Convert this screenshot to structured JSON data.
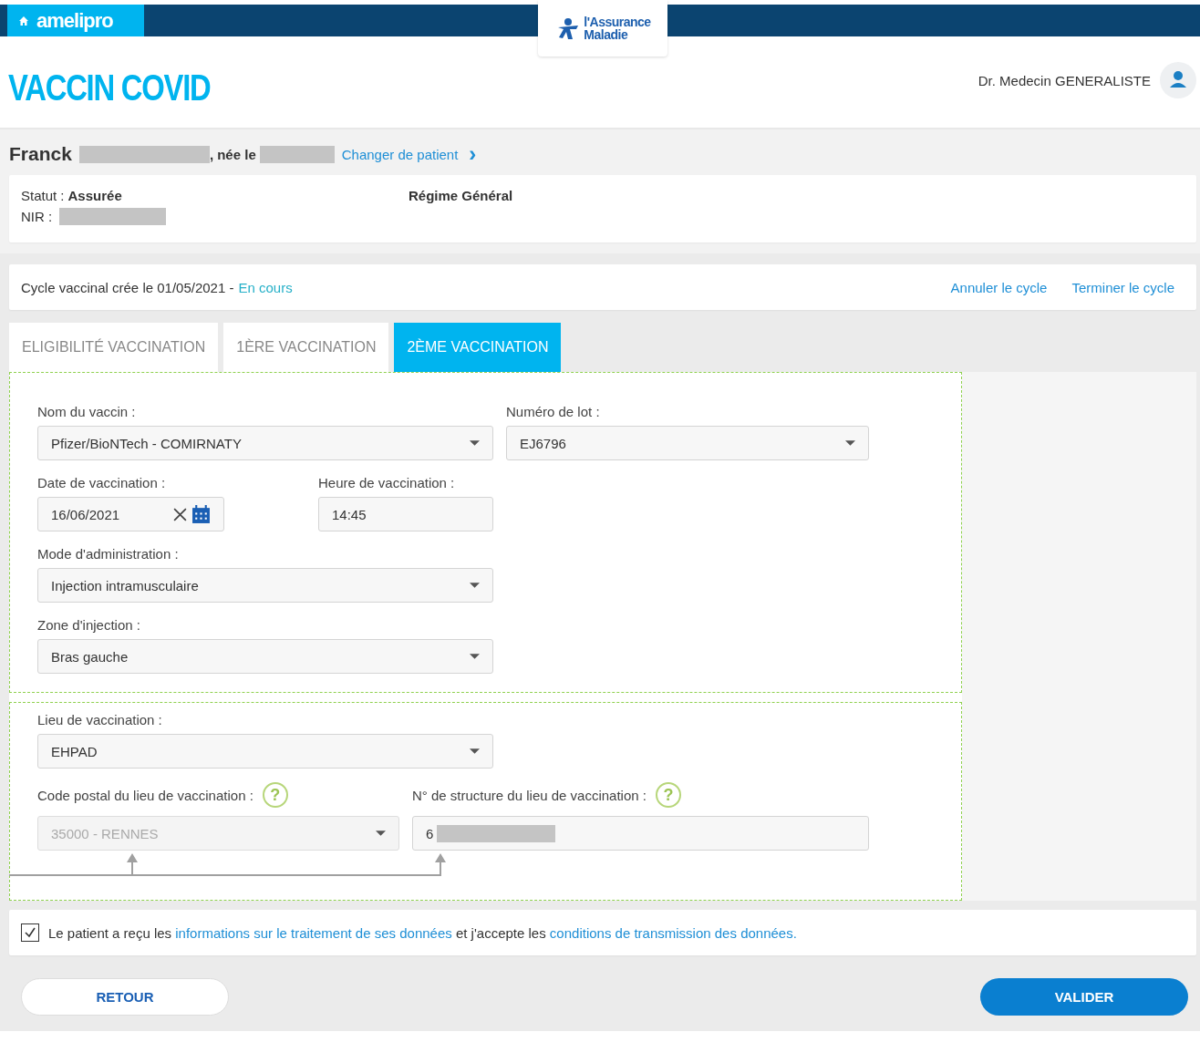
{
  "brand": {
    "name": "amelipro",
    "logo_line1": "l'Assurance",
    "logo_line2": "Maladie"
  },
  "title": "VACCIN COVID",
  "user": {
    "name": "Dr. Medecin GENERALISTE"
  },
  "patient": {
    "first_name": "Franck",
    "born_label": ", née le",
    "change_link": "Changer de patient",
    "chevron": "›"
  },
  "info": {
    "status_label": "Statut :",
    "status_value": "Assurée",
    "nir_label": "NIR :",
    "regime": "Régime Général"
  },
  "cycle": {
    "text": "Cycle vaccinal crée le 01/05/2021 -",
    "status": "En cours",
    "actions": [
      "Annuler le cycle",
      "Terminer le cycle"
    ]
  },
  "tabs": [
    {
      "label": "ELIGIBILITÉ VACCINATION",
      "selected": false
    },
    {
      "label": "1ÈRE VACCINATION",
      "selected": false
    },
    {
      "label": "2ÈME VACCINATION",
      "selected": true
    }
  ],
  "sections": [
    {
      "rows": [
        [
          {
            "label": "Nom du vaccin :",
            "value": "Pfizer/BioNTech - COMIRNATY",
            "kind": "select",
            "disabled": false
          },
          {
            "label": "Numéro de lot :",
            "value": "EJ6796",
            "kind": "select",
            "disabled": false
          }
        ],
        [
          {
            "label": "Date de vaccination :",
            "value": "16/06/2021",
            "kind": "date",
            "disabled": false
          },
          {
            "label": "Heure de vaccination :",
            "value": "14:45",
            "kind": "text",
            "disabled": false
          }
        ],
        [
          {
            "label": "Mode d'administration :",
            "value": "Injection intramusculaire",
            "kind": "select",
            "disabled": false
          }
        ],
        [
          {
            "label": "Zone d'injection :",
            "value": "Bras gauche",
            "kind": "select",
            "disabled": false
          }
        ]
      ]
    },
    {
      "rows": [
        [
          {
            "label": "Lieu de vaccination :",
            "value": "EHPAD",
            "kind": "select",
            "disabled": false
          }
        ],
        [
          {
            "label": "Code postal du lieu de vaccination :",
            "help": "?",
            "value": "35000 - RENNES",
            "kind": "select",
            "disabled": true
          },
          {
            "label": "N° de structure du lieu de vaccination :",
            "help": "?",
            "value": "6",
            "kind": "redacted",
            "disabled": false
          }
        ]
      ]
    }
  ],
  "consent": {
    "checked": true,
    "parts": [
      {
        "text": "Le patient a reçu les ",
        "kind": "plain"
      },
      {
        "text": "informations sur le traitement de ses données",
        "kind": "link"
      },
      {
        "text": " et j'accepte les ",
        "kind": "plain"
      },
      {
        "text": "conditions de transmission des données.",
        "kind": "link"
      }
    ]
  },
  "buttons": [
    {
      "label": "RETOUR",
      "kind": "secondary"
    },
    {
      "label": "VALIDER",
      "kind": "primary"
    }
  ]
}
